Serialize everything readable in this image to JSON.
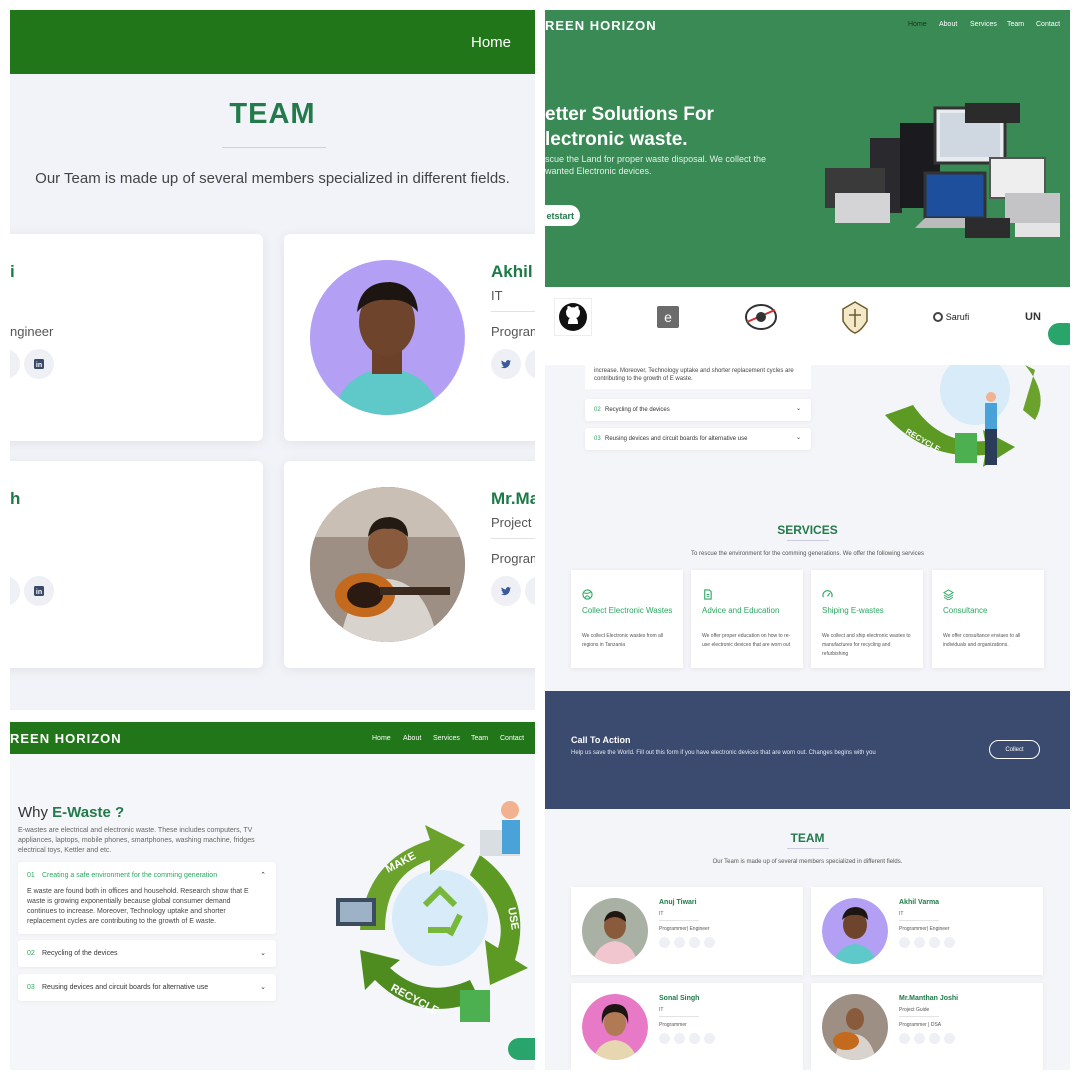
{
  "panel_team_zoom": {
    "nav_home": "Home",
    "title": "TEAM",
    "subtitle": "Our Team is made up of several members specialized in different fields.",
    "cards": [
      {
        "name": "i",
        "role_text": "ngineer"
      },
      {
        "name": "Akhil",
        "dept": "IT",
        "role_text": "Program"
      },
      {
        "name": "h"
      },
      {
        "name": "Mr.Ma",
        "dept": "Project",
        "role_text": "Program"
      }
    ]
  },
  "panel_hero": {
    "logo": "REEN HORIZON",
    "nav": [
      "Home",
      "About",
      "Services",
      "Team",
      "Contact"
    ],
    "headline_1": "etter Solutions For",
    "headline_2": "lectronic waste.",
    "paragraph_1": "scue the Land for proper waste disposal. We collect the",
    "paragraph_2": "wanted Electronic devices.",
    "cta": "etstart",
    "partners": {
      "sarufi": "Sarufi",
      "un": "UN"
    }
  },
  "panel_why": {
    "logo": "REEN HORIZON",
    "nav": [
      "Home",
      "About",
      "Services",
      "Team",
      "Contact"
    ],
    "heading_prefix": "Why",
    "heading_strong": "E-Waste ?",
    "intro": "E-wastes are electrical and electronic waste. These includes computers, TV appliances, laptops, mobile phones, smartphones, washing machine, fridges electrical toys, Kettler and etc.",
    "accordion": [
      {
        "num": "01",
        "title": "Creating a safe environment for the comming generation",
        "body": "E waste are found both in offices and household. Research show that E waste is growing exponentially because global consumer demand continues to increase. Moreover, Technology uptake and shorter replacement cycles are contributing to the growth of E waste."
      },
      {
        "num": "02",
        "title": "Recycling of the devices"
      },
      {
        "num": "03",
        "title": "Reusing devices and circuit boards for alternative use"
      }
    ],
    "illustration_labels": {
      "make": "MAKE",
      "use": "USE",
      "recycle": "RECYCLE"
    }
  },
  "panel_site": {
    "accordion_fragment": "increase. Moreover, Technology uptake and shorter replacement cycles are contributing to the growth of E waste.",
    "accordion": [
      {
        "num": "02",
        "title": "Recycling of the devices"
      },
      {
        "num": "03",
        "title": "Reusing devices and circuit boards for alternative use"
      }
    ],
    "services_title": "SERVICES",
    "services_subtitle": "To rescue the environment for the comming generations. We offer the following services",
    "services": [
      {
        "title": "Collect Electronic Wastes",
        "desc": "We collect Electronic wastes from all regions in Tanzania",
        "icon": "dribbble-icon"
      },
      {
        "title": "Advice and Education",
        "desc": "We offer proper education on how to re-use electronic devices that are worn out",
        "icon": "document-icon"
      },
      {
        "title": "Shiping E-wastes",
        "desc": "We collect and ship electronic wastes to manufactures for recycling and refurbishing",
        "icon": "speedometer-icon"
      },
      {
        "title": "Consultance",
        "desc": "We offer consultance enviaes to all individuals and organizations.",
        "icon": "layers-icon"
      }
    ],
    "cta_title": "Call To Action",
    "cta_text": "Help us save the World. Fill out this form if you have electronic devices that are worn out. Changes begins with you",
    "cta_button": "Collect",
    "team_title": "TEAM",
    "team_subtitle": "Our Team is made up of several members specialized in different fields.",
    "team": [
      {
        "name": "Anuj Tiwari",
        "dept": "IT",
        "position": "Programmer| Engineer"
      },
      {
        "name": "Akhil Varma",
        "dept": "IT",
        "position": "Programmer| Engineer"
      },
      {
        "name": "Sonal Singh",
        "dept": "IT",
        "position": "Programmer"
      },
      {
        "name": "Mr.Manthan Joshi",
        "dept": "Project Guide",
        "position": "Programmer | DSA"
      }
    ]
  }
}
